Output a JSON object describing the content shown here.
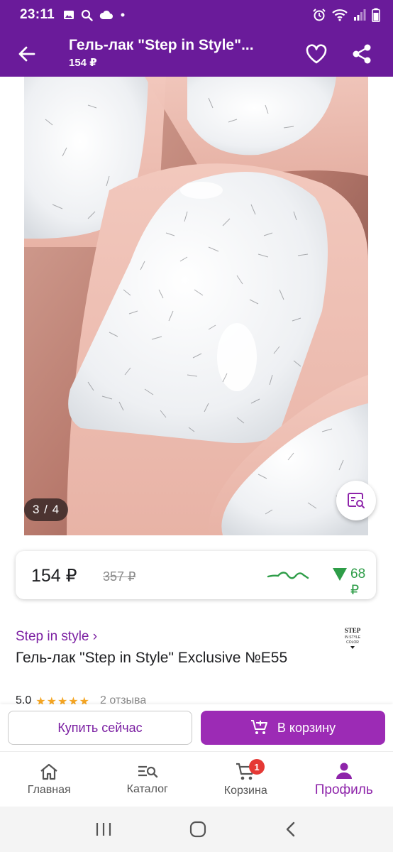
{
  "status_bar": {
    "time": "23:11",
    "left_icons": [
      "image-icon",
      "search-icon",
      "cloud-icon",
      "dot-icon"
    ],
    "right_icons": [
      "alarm-icon",
      "wifi-icon",
      "signal-icon",
      "battery-icon"
    ]
  },
  "app_bar": {
    "title": "Гель-лак \"Step in Style\"...",
    "subtitle": "154 ₽",
    "icons": [
      "back-arrow-icon",
      "heart-outline-icon",
      "share-icon"
    ]
  },
  "gallery": {
    "counter": "3 / 4",
    "current_index": 3,
    "total": 4
  },
  "price": {
    "current": "154 ₽",
    "old": "357 ₽",
    "drop": "68 ₽",
    "trend_color": "#2e9d48"
  },
  "product": {
    "brand": "Step in style ›",
    "name": "Гель-лак \"Step in Style\" Exclusive №E55",
    "rating": "5.0",
    "stars": "★★★★★",
    "reviews": "2 отзыва"
  },
  "actions": {
    "buy_now": "Купить сейчас",
    "add_to_cart": "В корзину"
  },
  "bottom_nav": {
    "items": [
      {
        "label": "Главная",
        "icon": "home-icon"
      },
      {
        "label": "Каталог",
        "icon": "catalog-search-icon"
      },
      {
        "label": "Корзина",
        "icon": "cart-icon",
        "badge": "1"
      },
      {
        "label": "Профиль",
        "icon": "profile-icon",
        "active": true
      }
    ]
  },
  "colors": {
    "brand_purple": "#6a1b9a",
    "accent_purple": "#9c2bb5",
    "price_drop_green": "#2e9d48",
    "badge_red": "#e53935"
  }
}
